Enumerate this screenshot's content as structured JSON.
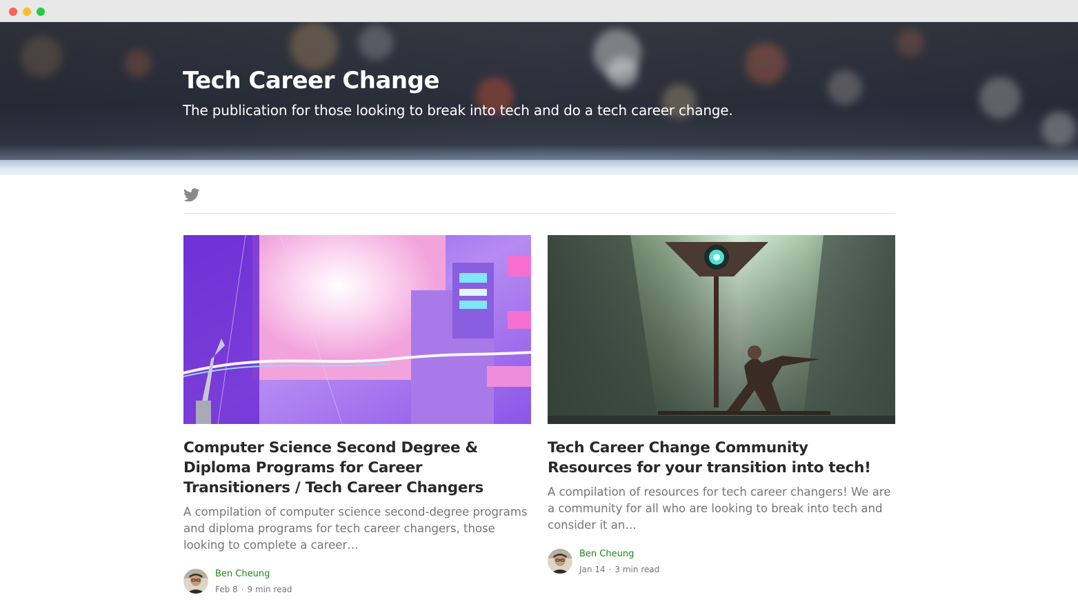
{
  "publication": {
    "title": "Tech Career Change",
    "tagline": "The publication for those looking to break into tech and do a tech career change."
  },
  "social": {
    "icon": "twitter-icon"
  },
  "colors": {
    "author": "#1a8917",
    "title": "#292929",
    "muted": "#757575"
  },
  "posts": [
    {
      "title": "Computer Science Second Degree & Diploma Programs for Career Transitioners / Tech Career Changers",
      "excerpt": "A compilation of computer science second-degree programs and diploma programs for tech career changers, those looking to complete a career…",
      "author": "Ben Cheung",
      "date": "Feb 8",
      "read_time": "9 min read"
    },
    {
      "title": "Tech Career Change Community Resources for your transition into tech!",
      "excerpt": "A compilation of resources for tech career changers! We are a community for all who are looking to break into tech and consider it an…",
      "author": "Ben Cheung",
      "date": "Jan 14",
      "read_time": "3 min read"
    }
  ]
}
